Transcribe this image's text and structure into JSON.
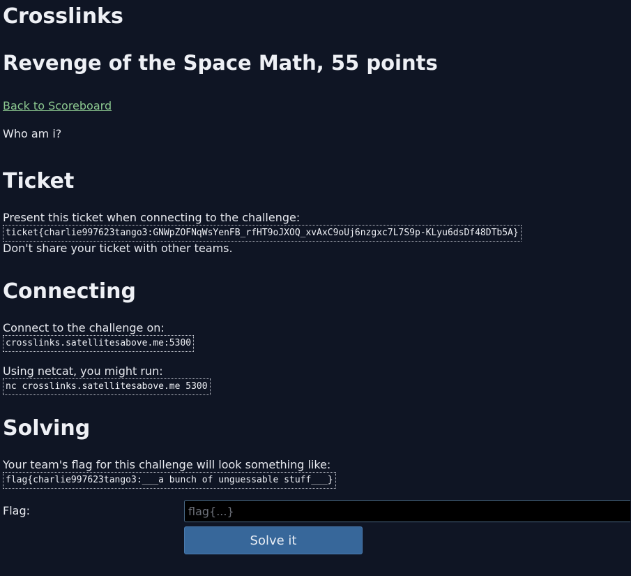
{
  "site": {
    "title": "Crosslinks"
  },
  "challenge": {
    "title": "Revenge of the Space Math, 55 points",
    "back_link": "Back to Scoreboard",
    "description": "Who am i?"
  },
  "ticket": {
    "heading": "Ticket",
    "intro": "Present this ticket when connecting to the challenge:",
    "value": "ticket{charlie997623tango3:GNWpZOFNqWsYenFB_rfHT9oJXOQ_xvAxC9oUj6nzgxc7L7S9p-KLyu6dsDf48DTb5A}",
    "warning": "Don't share your ticket with other teams."
  },
  "connecting": {
    "heading": "Connecting",
    "intro": "Connect to the challenge on:",
    "host": "crosslinks.satellitesabove.me:5300",
    "netcat_intro": "Using netcat, you might run:",
    "netcat_cmd": "nc crosslinks.satellitesabove.me 5300"
  },
  "solving": {
    "heading": "Solving",
    "intro": "Your team's flag for this challenge will look something like:",
    "flag_example": "flag{charlie997623tango3:___a bunch of unguessable stuff___}",
    "flag_label": "Flag:",
    "flag_placeholder": "flag{...}",
    "flag_value": "",
    "submit_label": "Solve it"
  },
  "colors": {
    "background": "#0f1524",
    "link": "#8bc78f",
    "button": "#37679a"
  }
}
